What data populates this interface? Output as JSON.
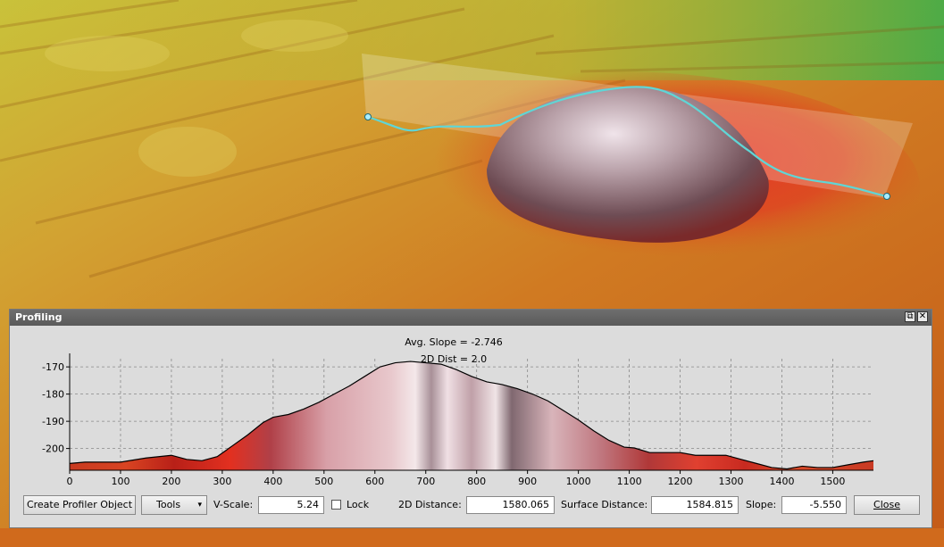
{
  "panel": {
    "title": "Profiling",
    "restore_glyph": "⧉",
    "close_glyph": "✕"
  },
  "chart_data": {
    "type": "area",
    "annotations": [
      "Avg. Slope = -2.746",
      "2D Dist = 2.0"
    ],
    "xlim": [
      0,
      1580
    ],
    "ylim": [
      -208,
      -167
    ],
    "x_ticks": [
      0,
      100,
      200,
      300,
      400,
      500,
      600,
      700,
      800,
      900,
      1000,
      1100,
      1200,
      1300,
      1400,
      1500
    ],
    "y_ticks": [
      -170,
      -180,
      -190,
      -200
    ],
    "grid": true,
    "x": [
      0,
      30,
      60,
      100,
      150,
      200,
      230,
      260,
      290,
      320,
      350,
      380,
      400,
      430,
      460,
      490,
      520,
      550,
      580,
      610,
      640,
      670,
      700,
      730,
      760,
      790,
      820,
      850,
      880,
      910,
      940,
      970,
      1000,
      1030,
      1060,
      1090,
      1110,
      1140,
      1170,
      1200,
      1230,
      1260,
      1290,
      1320,
      1350,
      1380,
      1410,
      1440,
      1470,
      1500,
      1530,
      1560,
      1580
    ],
    "y": [
      -205.5,
      -205,
      -205,
      -205,
      -203.5,
      -202.5,
      -204,
      -204.5,
      -203,
      -199,
      -195,
      -190.5,
      -188.5,
      -187.5,
      -185.5,
      -183,
      -180,
      -177,
      -173.5,
      -170,
      -168.5,
      -168,
      -168.5,
      -169,
      -171,
      -173.5,
      -175.5,
      -176.5,
      -178,
      -180,
      -182.5,
      -186,
      -189.5,
      -193.5,
      -197,
      -199.5,
      -199.8,
      -201.5,
      -201.5,
      -201.5,
      -202.5,
      -202.5,
      -202.5,
      -204,
      -205.5,
      -207,
      -207.5,
      -206.5,
      -207,
      -207,
      -206,
      -205,
      -204.5
    ]
  },
  "controls": {
    "create_profiler_label": "Create Profiler Object",
    "tools_label": "Tools",
    "tools_arrow": "▾",
    "vscale_label": "V-Scale:",
    "vscale_value": "5.24",
    "lock_label": "Lock",
    "dist2d_label": "2D Distance:",
    "dist2d_value": "1580.065",
    "surface_label": "Surface Distance:",
    "surface_value": "1584.815",
    "slope_label": "Slope:",
    "slope_value": "-5.550",
    "close_label": "Close"
  }
}
